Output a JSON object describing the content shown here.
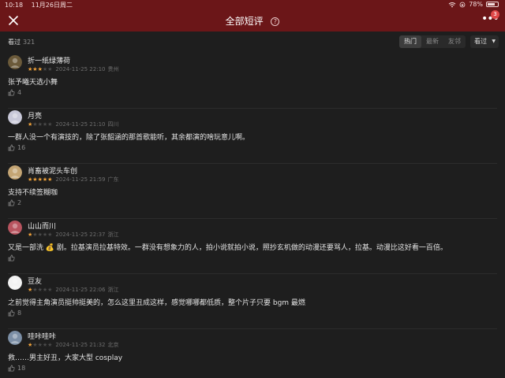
{
  "status": {
    "time": "10:18",
    "date": "11月26日周二",
    "battery": "78%",
    "battery_level": 0.78
  },
  "nav": {
    "title": "全部短评",
    "help_symbol": "?",
    "more_symbol": "•••",
    "badge": "3"
  },
  "filter": {
    "watched_label": "看过",
    "watched_count": "321",
    "tabs": [
      "热门",
      "最新",
      "友邻"
    ],
    "active_tab": 0,
    "view_label": "看过",
    "view_caret": "▼"
  },
  "reviews": [
    {
      "user": "折一纸绿薄荷",
      "rating": 3,
      "date": "2024-11-25 22:10",
      "region": "贵州",
      "content": "张予曦天选小舞",
      "likes": "4",
      "avatar_color": "#6b5a3a"
    },
    {
      "user": "月亮",
      "rating": 1,
      "date": "2024-11-25 21:10",
      "region": "四川",
      "content": "一群人没一个有演技的，除了张韶涵的那首歌能听，其余都演的啥玩意儿啊。",
      "likes": "16",
      "avatar_color": "#c9c9d9"
    },
    {
      "user": "肖畜被泥头车创",
      "rating": 5,
      "date": "2024-11-25 21:59",
      "region": "广东",
      "content": "支持不续签糊咖",
      "likes": "2",
      "avatar_color": "#c4a574"
    },
    {
      "user": "山山而川",
      "rating": 1,
      "date": "2024-11-25 22:37",
      "region": "浙江",
      "content": "又是一部洗 💰 剧。拉基演员拉基特效。一群没有想象力的人，拍小说就拍小说，照抄玄机做的动漫还要骂人，拉基。动漫比这好看一百倍。",
      "likes": "",
      "avatar_color": "#b8545f"
    },
    {
      "user": "豆友",
      "rating": 1,
      "date": "2024-11-25 22:06",
      "region": "浙江",
      "content": "之前觉得主角演员挺帅挺美的，怎么这里丑成这样，感觉哪哪都低质，整个片子只要 bgm 最燃",
      "likes": "8",
      "avatar_color": "#f2f2f2"
    },
    {
      "user": "哇咔哇咔",
      "rating": 1,
      "date": "2024-11-25 21:32",
      "region": "北京",
      "content": "救……男主好丑，大家大型 cosplay",
      "likes": "18",
      "avatar_color": "#7c8fa6"
    }
  ],
  "colors": {
    "header_bg": "#6b1618",
    "page_bg": "#1e1e1e",
    "star_on": "#f2a33a",
    "star_off": "#4a4a4a",
    "badge": "#e04848"
  },
  "icons": {
    "close": "close-icon",
    "help": "help-icon",
    "more": "more-icon",
    "wifi": "wifi-icon",
    "battery": "battery-icon",
    "star": "star-icon",
    "like": "thumbs-up-icon"
  }
}
